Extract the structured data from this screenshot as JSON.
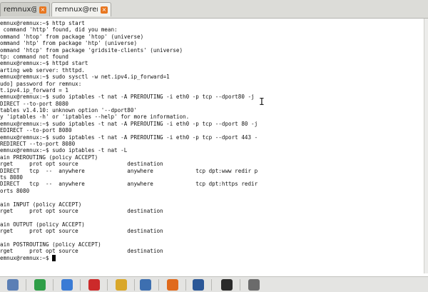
{
  "tabs": [
    {
      "label": "remnux@remn...",
      "close": "×",
      "active": false
    },
    {
      "label": "remnux@rem...",
      "close": "×",
      "active": true
    }
  ],
  "terminal": {
    "lines": [
      "emnux@remnux:~$ http start",
      " command 'http' found, did you mean:",
      "ommand 'htop' from package 'htop' (universe)",
      "ommand 'htp' from package 'htp' (universe)",
      "ommand 'htcp' from package 'gridsite-clients' (universe)",
      "tp: command not found",
      "emnux@remnux:~$ httpd start",
      "arting web server: thttpd.",
      "emnux@remnux:~$ sudo sysctl -w net.ipv4.ip_forward=1",
      "udo] password for remnux:",
      "t.ipv4.ip_forward = 1",
      "emnux@remnux:~$ sudo iptables -t nat -A PREROUTING -i eth0 -p tcp --dport80 -j",
      "DIRECT --to-port 8080",
      "tables v1.4.10: unknown option '--dport80'",
      "y 'iptables -h' or 'iptables --help' for more information.",
      "emnux@remnux:~$ sudo iptables -t nat -A PREROUTING -i eth0 -p tcp --dport 80 -j",
      "EDIRECT --to-port 8080",
      "emnux@remnux:~$ sudo iptables -t nat -A PREROUTING -i eth0 -p tcp --dport 443 -",
      "REDIRECT --to-port 8080",
      "emnux@remnux:~$ sudo iptables -t nat -L",
      "ain PREROUTING (policy ACCEPT)",
      "rget     prot opt source               destination",
      "DIRECT   tcp  --  anywhere             anywhere             tcp dpt:www redir p",
      "ts 8080",
      "DIRECT   tcp  --  anywhere             anywhere             tcp dpt:https redir",
      "orts 8080",
      "",
      "ain INPUT (policy ACCEPT)",
      "rget     prot opt source               destination",
      "",
      "ain OUTPUT (policy ACCEPT)",
      "rget     prot opt source               destination",
      "",
      "ain POSTROUTING (policy ACCEPT)",
      "rget     prot opt source               destination",
      "emnux@remnux:~$ "
    ],
    "mouse_pointer": "I"
  },
  "taskbar": {
    "icons": [
      {
        "name": "app-icon",
        "color": "#5b7fb5"
      },
      {
        "name": "chrome-icon",
        "color": "#2f9e48"
      },
      {
        "name": "browser-icon",
        "color": "#3a7bd5"
      },
      {
        "name": "opera-icon",
        "color": "#cc2a2a"
      },
      {
        "name": "folder-icon",
        "color": "#d9a72a"
      },
      {
        "name": "virtualbox-icon",
        "color": "#3d6fb0"
      },
      {
        "name": "firefox-icon",
        "color": "#e06a1c"
      },
      {
        "name": "word-icon",
        "color": "#2b5797"
      },
      {
        "name": "terminal-icon",
        "color": "#2a2a2a"
      },
      {
        "name": "window-icon",
        "color": "#6b6b6b"
      }
    ]
  }
}
